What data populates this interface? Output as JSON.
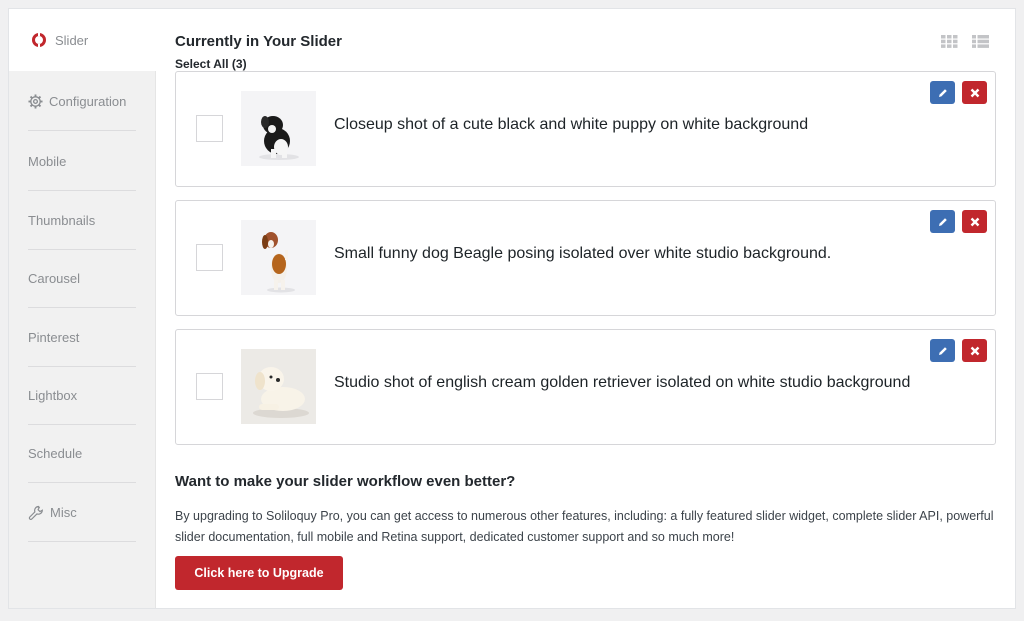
{
  "sidebar": {
    "active": {
      "label": "Slider",
      "icon": "soliloquy-logo-icon"
    },
    "items": [
      {
        "label": "Configuration",
        "icon": "gear-icon"
      },
      {
        "label": "Mobile"
      },
      {
        "label": "Thumbnails"
      },
      {
        "label": "Carousel"
      },
      {
        "label": "Pinterest"
      },
      {
        "label": "Lightbox"
      },
      {
        "label": "Schedule"
      },
      {
        "label": "Misc",
        "icon": "wrench-icon"
      }
    ]
  },
  "main": {
    "title": "Currently in Your Slider",
    "select_all": "Select All (3)",
    "view_icons": [
      "grid-view-icon",
      "list-view-icon"
    ],
    "slides": [
      {
        "caption": "Closeup shot of a cute black and white puppy on white background",
        "thumb": "puppy-photo"
      },
      {
        "caption": "Small funny dog Beagle posing isolated over white studio background.",
        "thumb": "beagle-photo"
      },
      {
        "caption": "Studio shot of english cream golden retriever isolated on white studio background",
        "thumb": "retriever-photo"
      }
    ]
  },
  "upgrade": {
    "title": "Want to make your slider workflow even better?",
    "text": "By upgrading to Soliloquy Pro, you can get access to numerous other features, including: a fully featured slider widget, complete slider API, powerful slider documentation, full mobile and Retina support, dedicated customer support and so much more!",
    "button": "Click here to Upgrade"
  },
  "colors": {
    "primary_red": "#c1272d",
    "edit_blue": "#3d6eb3"
  }
}
